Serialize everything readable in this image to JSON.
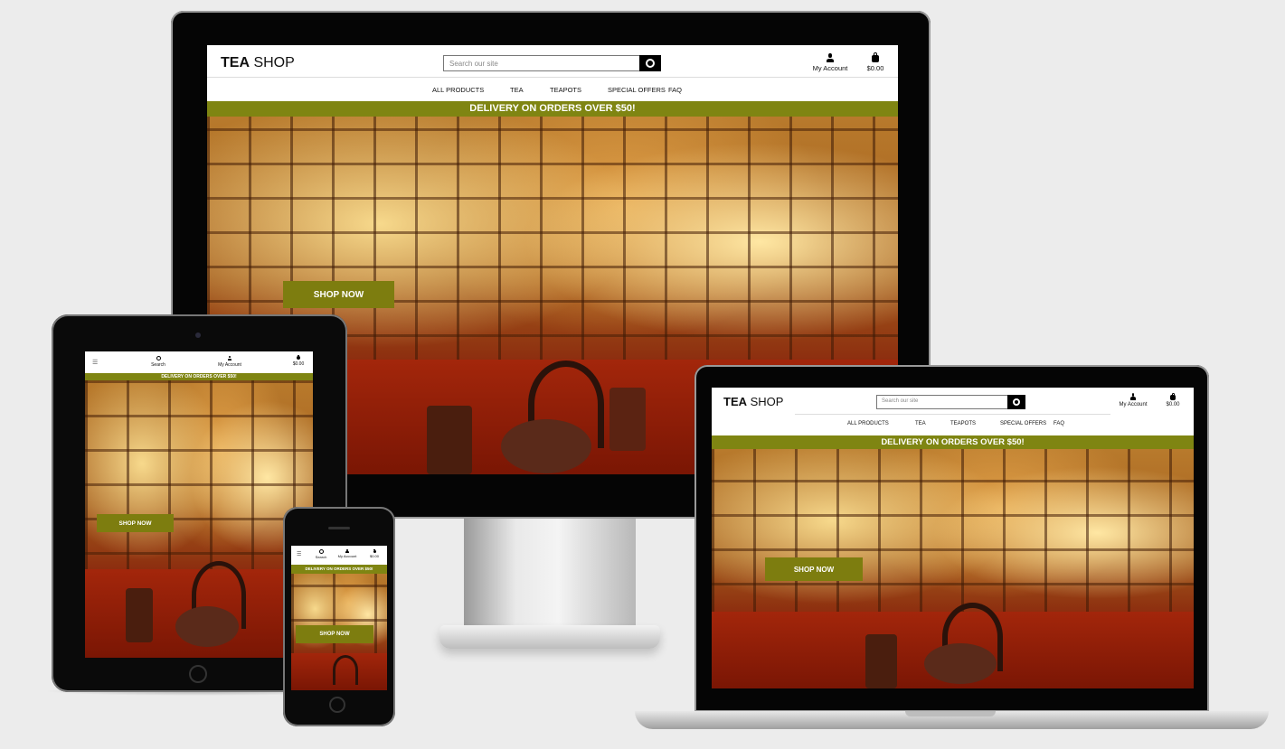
{
  "site": {
    "logo_bold": "TEA",
    "logo_light": "SHOP",
    "search_placeholder": "Search our site",
    "search_label": "Search",
    "account_label": "My Account",
    "cart_total": "$0.00",
    "nav": [
      "ALL PRODUCTS",
      "TEA",
      "TEAPOTS",
      "SPECIAL OFFERS",
      "FAQ"
    ],
    "banner": "DELIVERY ON ORDERS OVER $50!",
    "cta": "SHOP NOW",
    "menu_icon": "☰",
    "search_icon": "🔍"
  },
  "colors": {
    "banner": "#7f8512",
    "button": "#7d7d0f",
    "device_frame": "#0a0a0a",
    "background": "#ececec"
  }
}
